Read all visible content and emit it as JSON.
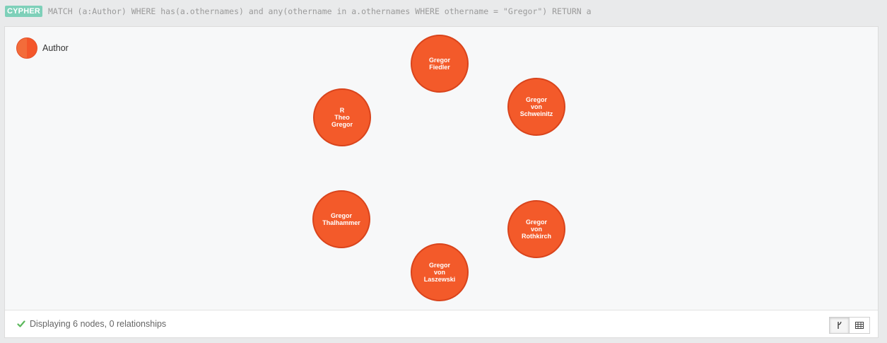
{
  "query": {
    "badge": "CYPHER",
    "text": "MATCH (a:Author) WHERE has(a.othernames) and any(othername in a.othernames WHERE othername = \"Gregor\") RETURN a"
  },
  "legend": {
    "label": "Author",
    "color": "#f4562a"
  },
  "nodes": [
    {
      "lines": [
        "Gregor",
        "Fiedler"
      ]
    },
    {
      "lines": [
        "Gregor",
        "von",
        "Schweinitz"
      ]
    },
    {
      "lines": [
        "R",
        "Theo",
        "Gregor"
      ]
    },
    {
      "lines": [
        "Gregor",
        "Thalhammer"
      ]
    },
    {
      "lines": [
        "Gregor",
        "von",
        "Rothkirch"
      ]
    },
    {
      "lines": [
        "Gregor",
        "von",
        "Laszewski"
      ]
    }
  ],
  "status": {
    "text": "Displaying 6 nodes, 0 relationships",
    "icon": "check-icon"
  },
  "view_buttons": [
    {
      "name": "graph-view",
      "icon": "graph-icon",
      "active": true
    },
    {
      "name": "table-view",
      "icon": "table-icon",
      "active": false
    }
  ],
  "colors": {
    "node_fill": "#f35a2a",
    "node_stroke": "#d9441c",
    "badge": "#7ed0b9",
    "success": "#5cb85c"
  }
}
